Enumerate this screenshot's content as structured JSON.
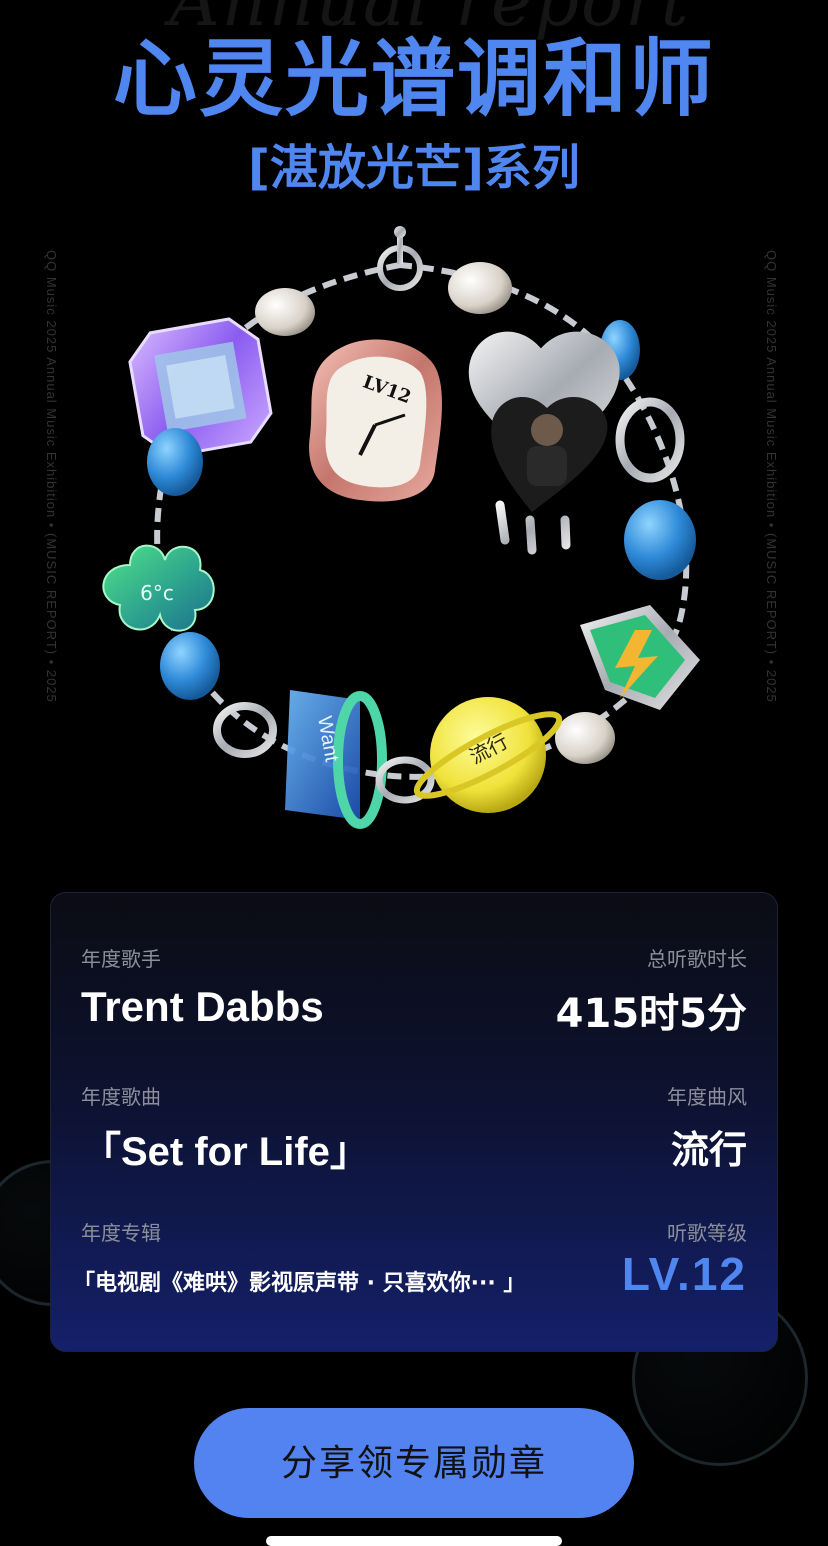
{
  "watermark": "Annual report",
  "title": "心灵光谱调和师",
  "subtitle": "[湛放光芒]系列",
  "side_text": "QQ Music 2025 Annual Music Exhibition  •  (MUSIC REPORT)  •  2025",
  "bracelet": {
    "clock_label": "LV12",
    "clover_label": "6°c",
    "ring_label": "Want",
    "ball_label": "流行"
  },
  "stats": {
    "artist_label": "年度歌手",
    "artist_value": "Trent Dabbs",
    "duration_label": "总听歌时长",
    "duration_value": "415时5分",
    "song_label": "年度歌曲",
    "song_value": "「Set for Life」",
    "genre_label": "年度曲风",
    "genre_value": "流行",
    "album_label": "年度专辑",
    "album_value": "「电视剧《难哄》影视原声带 · 只喜欢你··· 」",
    "level_label": "听歌等级",
    "level_value": "LV.12"
  },
  "share_button": "分享领专属勋章",
  "colors": {
    "accent": "#4f86ef",
    "button": "#5283f0",
    "background": "#000000"
  }
}
